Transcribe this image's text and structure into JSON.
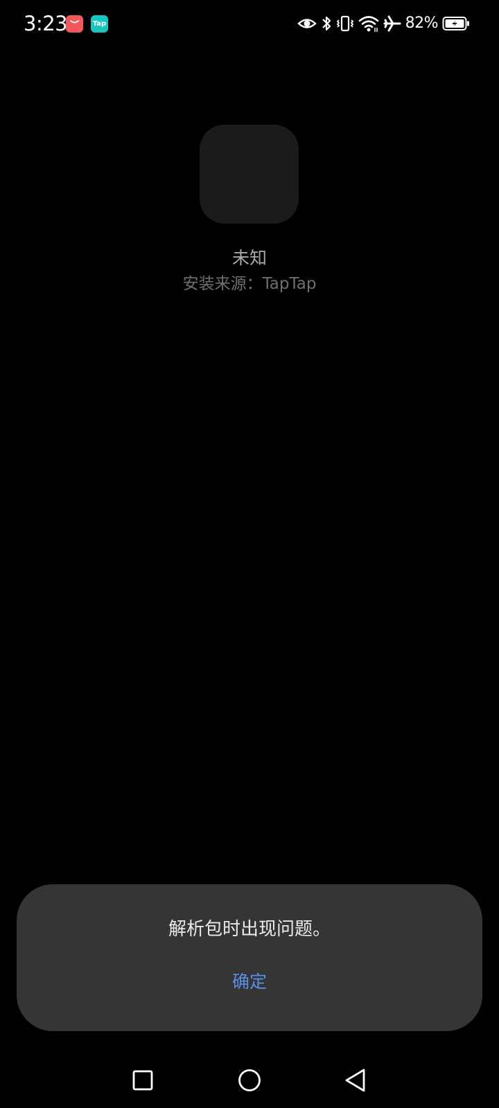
{
  "status_bar": {
    "time": "3:23",
    "notification_icons": [
      "shopping-bag-icon",
      "taptap-icon"
    ],
    "taptap_label": "Tap",
    "system_icons": [
      "eye-icon",
      "bluetooth-icon",
      "vibrate-icon",
      "wifi-icon",
      "airplane-mode-icon",
      "battery-charging-icon"
    ],
    "battery_percent": "82%"
  },
  "app_info": {
    "name": "未知",
    "source": "安装来源：TapTap"
  },
  "dialog": {
    "message": "解析包时出现问题。",
    "confirm_label": "确定",
    "confirm_color": "#5a8ee6"
  },
  "nav_bar": {
    "buttons": [
      "recents-icon",
      "home-icon",
      "back-icon"
    ]
  },
  "colors": {
    "background": "#000000",
    "dialog_background": "#353535",
    "app_icon_placeholder": "#1b1b1b"
  }
}
